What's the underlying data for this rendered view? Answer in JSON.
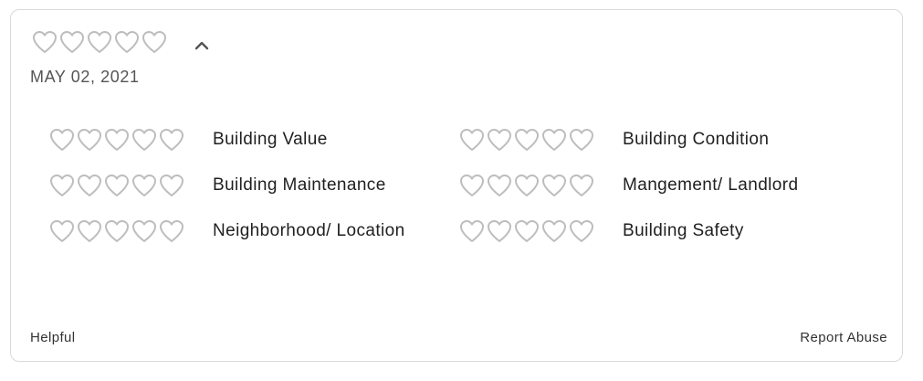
{
  "review": {
    "overall_rating": 0,
    "overall_max": 5,
    "date": "MAY 02, 2021",
    "ratings": [
      {
        "label": "Building Value",
        "value": 0
      },
      {
        "label": "Building Condition",
        "value": 0
      },
      {
        "label": "Building Maintenance",
        "value": 0
      },
      {
        "label": "Mangement/ Landlord",
        "value": 0
      },
      {
        "label": "Neighborhood/ Location",
        "value": 0
      },
      {
        "label": "Building Safety",
        "value": 0
      }
    ]
  },
  "footer": {
    "helpful_label": "Helpful",
    "report_label": "Report Abuse"
  },
  "colors": {
    "heart_outline": "#bdbdbd",
    "chevron": "#555555"
  }
}
